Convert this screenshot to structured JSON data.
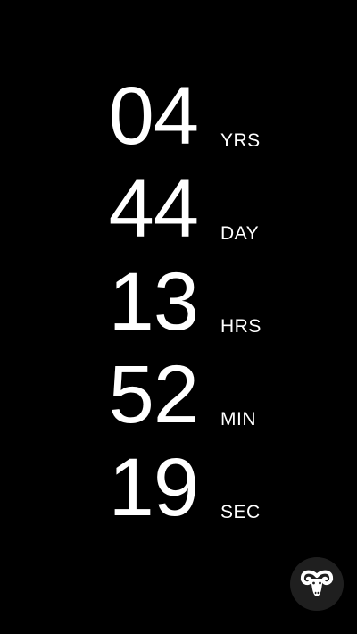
{
  "countdown": {
    "years": {
      "value": "04",
      "unit": "YRS"
    },
    "days": {
      "value": "44",
      "unit": "DAY"
    },
    "hours": {
      "value": "13",
      "unit": "HRS"
    },
    "minutes": {
      "value": "52",
      "unit": "MIN"
    },
    "seconds": {
      "value": "19",
      "unit": "SEC"
    }
  },
  "logo_button": {
    "icon": "ram-head-icon"
  },
  "colors": {
    "background": "#000000",
    "text": "#ffffff",
    "button_background": "#1f1f1f"
  }
}
